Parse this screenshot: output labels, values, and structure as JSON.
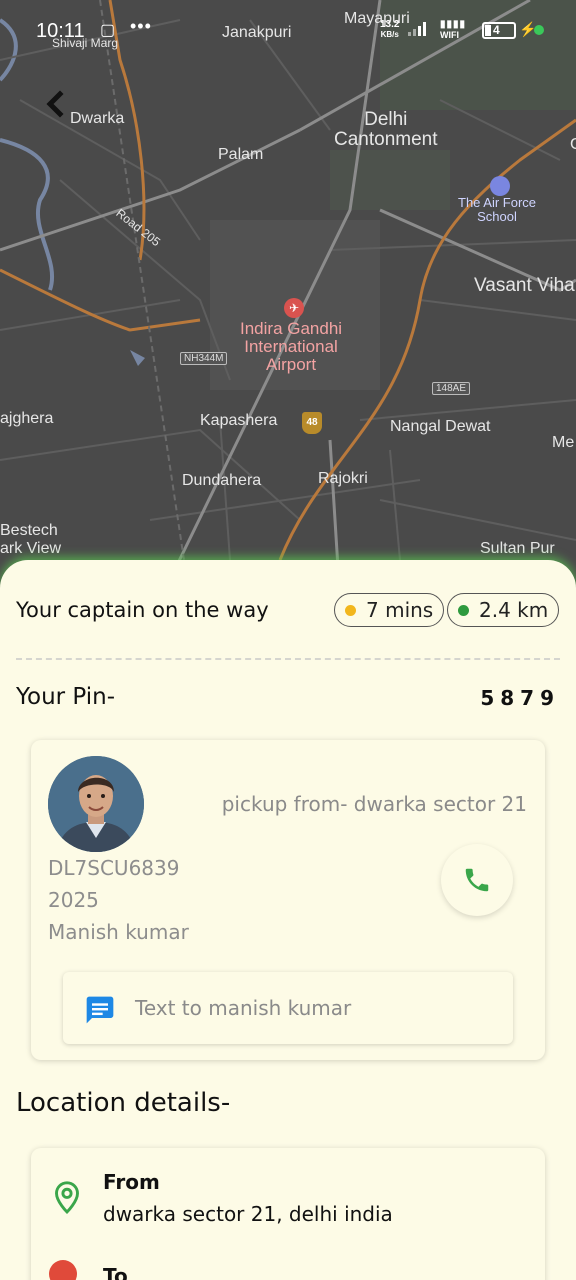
{
  "status_bar": {
    "time": "10:11",
    "notification_icon": "screen-record-icon",
    "more": "•••",
    "net_speed_value": "13.2",
    "net_speed_unit": "KB/s",
    "wifi_label": "WIFI",
    "battery_level": "4"
  },
  "map": {
    "labels": {
      "mayapuri": "Mayapuri",
      "shivaji_marg": "Shivaji Marg",
      "janakpuri": "Janakpuri",
      "dwarka": "Dwarka",
      "palam": "Palam",
      "delhi_cantonment": "Delhi\nCantonment",
      "air_force_school": "The Air Force\nSchool",
      "road_205": "Road 205",
      "vasant_vihar": "Vasant Viha",
      "airport": "Indira Gandhi\nInternational\nAirport",
      "nh344m": "NH344M",
      "ajghera": "ajghera",
      "kapashera": "Kapashera",
      "nh48": "48",
      "nangal_dewat": "Nangal Dewat",
      "road_148ae": "148AE",
      "me": "Me",
      "dundahera": "Dundahera",
      "rajokri": "Rajokri",
      "bestech": "Bestech",
      "park_view": "ark View",
      "sultan_pur": "Sultan Pur",
      "g": "G"
    }
  },
  "ride": {
    "eta_title": "Your captain on the way",
    "eta_time": "7 mins",
    "eta_distance": "2.4 km",
    "pin_label": "Your Pin-",
    "pin_value": "5879"
  },
  "driver": {
    "pickup": "pickup from- dwarka sector 21",
    "vehicle_number": "DL7SCU6839",
    "vehicle_model": "2025",
    "name": "Manish kumar",
    "message_placeholder": "Text to manish kumar"
  },
  "location": {
    "title": "Location details-",
    "from_label": "From",
    "from_value": "dwarka sector 21, delhi india",
    "to_label": "To"
  },
  "colors": {
    "sheet_bg": "#fdfbe6",
    "accent_green": "#3aa64a",
    "eta_dot": "#f2b61c",
    "distance_dot": "#2e9a3e",
    "message_blue": "#1e88e5",
    "to_red": "#e04a3a"
  }
}
